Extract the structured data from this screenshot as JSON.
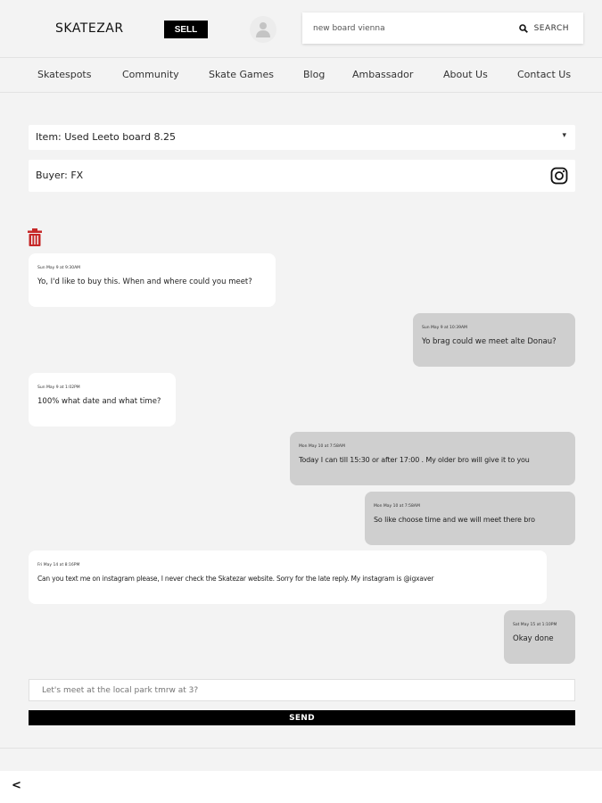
{
  "header": {
    "logo": "SKATEZAR",
    "sell_label": "SELL",
    "search": {
      "value": "new board vienna",
      "button_label": "SEARCH"
    }
  },
  "nav": [
    "Skatespots",
    "Community",
    "Skate Games",
    "Blog",
    "Ambassador",
    "About Us",
    "Contact Us"
  ],
  "conversation": {
    "item_label": "Item: Used Leeto board 8.25",
    "buyer_label": "Buyer: FX"
  },
  "messages": [
    {
      "direction": "in",
      "timestamp": "Sun May 9 at 9:30AM",
      "text": "Yo, I'd like to buy this. When and where could you meet?"
    },
    {
      "direction": "out",
      "timestamp": "Sun May 9 at 10:39AM",
      "text": "Yo brag could we meet alte Donau?"
    },
    {
      "direction": "in",
      "timestamp": "Sun May 9 at 1:02PM",
      "text": "100% what date and what time?"
    },
    {
      "direction": "out",
      "timestamp": "Mon May 10 at 7:58AM",
      "text": "Today I can till 15:30 or after 17:00 . My older bro will give it to you"
    },
    {
      "direction": "out",
      "timestamp": "Mon May 10 at 7:58AM",
      "text": "So like choose time and we will meet there bro"
    },
    {
      "direction": "in",
      "timestamp": "Fri May 14 at 8:16PM",
      "text": "Can you text me on instagram please, I never check the Skatezar website. Sorry for the late reply. My instagram is @igxaver"
    },
    {
      "direction": "out",
      "timestamp": "Sat May 15 at 1:10PM",
      "text": "Okay done"
    }
  ],
  "composer": {
    "placeholder": "Let's meet at the local park tmrw at 3?",
    "send_label": "SEND"
  },
  "footer": {
    "back_label": "<"
  },
  "colors": {
    "accent": "#000000",
    "incoming_bubble": "#ffffff",
    "outgoing_bubble": "#cfcfcf",
    "trash": "#c62828"
  }
}
